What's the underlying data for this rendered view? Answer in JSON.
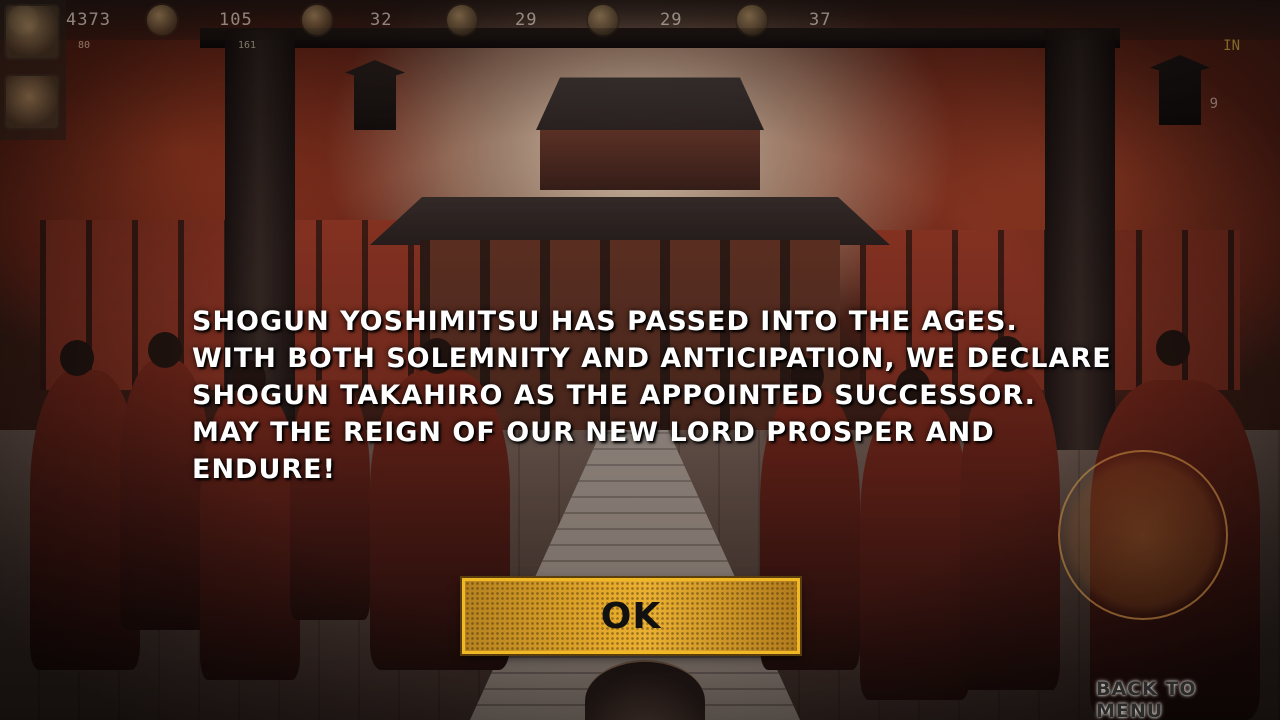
{
  "dialog": {
    "message": "SHOGUN YOSHIMITSU HAS PASSED INTO THE AGES. WITH BOTH SOLEMNITY AND ANTICIPATION, WE DECLARE SHOGUN TAKAHIRO AS THE APPOINTED SUCCESSOR. MAY THE REIGN OF OUR NEW LORD PROSPER AND ENDURE!",
    "ok_label": "OK"
  },
  "hud": {
    "resources": [
      {
        "icon": "coin-icon",
        "value": "4373",
        "sub": "80"
      },
      {
        "icon": "people-icon",
        "value": "105",
        "sub": "161"
      },
      {
        "icon": "scroll-icon",
        "value": "32"
      },
      {
        "icon": "fan-icon",
        "value": "29"
      },
      {
        "icon": "armor-icon",
        "value": "29"
      },
      {
        "icon": "helmet-icon",
        "value": "37"
      }
    ],
    "right_top": "IN",
    "right_value": "9"
  },
  "footer": {
    "back_to_menu": "BACK TO MENU"
  },
  "colors": {
    "button_gold": "#e7ab2b",
    "button_border": "#f1b826",
    "message_text": "#ffffff"
  }
}
